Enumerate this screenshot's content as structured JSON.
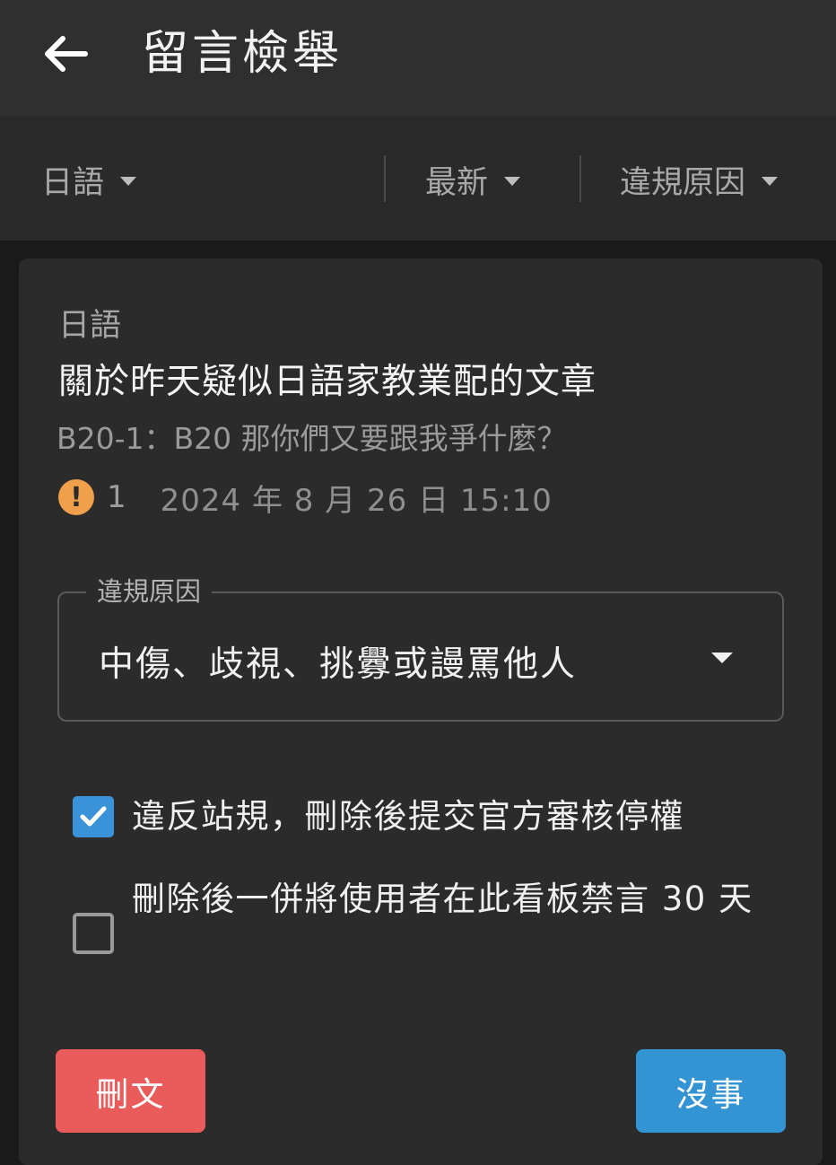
{
  "header": {
    "title": "留言檢舉",
    "back_icon": "arrow-left-icon"
  },
  "filters": {
    "language": "日語",
    "sort": "最新",
    "reason": "違規原因"
  },
  "report": {
    "language": "日語",
    "post_title": "關於昨天疑似日語家教業配的文章",
    "comment": "B20-1：B20 那你們又要跟我爭什麼？",
    "report_count": "1",
    "timestamp": "2024 年 8 月 26 日 15:10",
    "warning_icon_color": "#f0a04b",
    "violation_select": {
      "label": "違規原因",
      "value": "中傷、歧視、挑釁或謾罵他人"
    },
    "options": [
      {
        "label": "違反站規，刪除後提交官方審核停權",
        "checked": true
      },
      {
        "label": "刪除後一併將使用者在此看板禁言 30 天",
        "checked": false
      }
    ]
  },
  "actions": {
    "delete_label": "刪文",
    "delete_color": "#ea5b5b",
    "dismiss_label": "沒事",
    "dismiss_color": "#3294d2"
  }
}
